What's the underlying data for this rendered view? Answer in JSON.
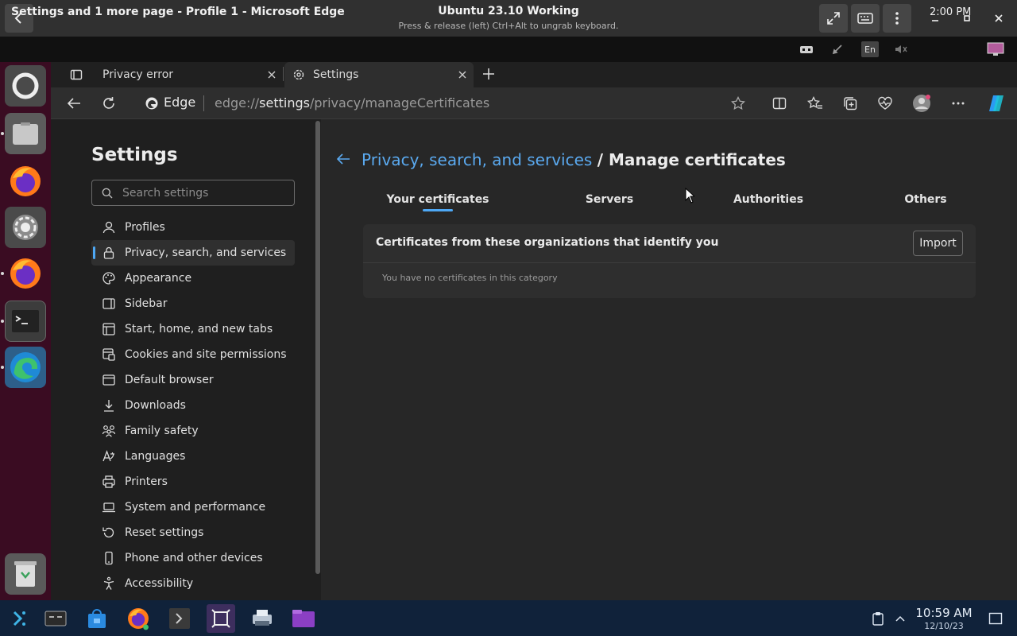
{
  "vm": {
    "title": "Ubuntu 23.10 Working",
    "subtitle": "Press & release (left) Ctrl+Alt to ungrab keyboard."
  },
  "panel": {
    "window_title": "Settings and 1 more page - Profile 1 - Microsoft Edge",
    "keyboard_layout": "En",
    "time": "2:00 PM"
  },
  "browser": {
    "tabs": [
      {
        "label": "Privacy error"
      },
      {
        "label": "Settings"
      }
    ],
    "site_label": "Edge",
    "url_prefix": "edge://",
    "url_strong": "settings",
    "url_rest": "/privacy/manageCertificates"
  },
  "settings": {
    "title": "Settings",
    "search_placeholder": "Search settings",
    "nav": [
      {
        "label": "Profiles",
        "icon": "profile-icon"
      },
      {
        "label": "Privacy, search, and services",
        "icon": "lock-icon"
      },
      {
        "label": "Appearance",
        "icon": "appearance-icon"
      },
      {
        "label": "Sidebar",
        "icon": "sidebar-icon"
      },
      {
        "label": "Start, home, and new tabs",
        "icon": "home-icon"
      },
      {
        "label": "Cookies and site permissions",
        "icon": "cookies-icon"
      },
      {
        "label": "Default browser",
        "icon": "browser-icon"
      },
      {
        "label": "Downloads",
        "icon": "download-icon"
      },
      {
        "label": "Family safety",
        "icon": "family-icon"
      },
      {
        "label": "Languages",
        "icon": "language-icon"
      },
      {
        "label": "Printers",
        "icon": "printer-icon"
      },
      {
        "label": "System and performance",
        "icon": "laptop-icon"
      },
      {
        "label": "Reset settings",
        "icon": "reset-icon"
      },
      {
        "label": "Phone and other devices",
        "icon": "phone-icon"
      },
      {
        "label": "Accessibility",
        "icon": "accessibility-icon"
      }
    ]
  },
  "certificates": {
    "breadcrumb_parent": "Privacy, search, and services",
    "breadcrumb_current": "/ Manage certificates",
    "tabs": [
      "Your certificates",
      "Servers",
      "Authorities",
      "Others"
    ],
    "card_heading": "Certificates from these organizations that identify you",
    "import_label": "Import",
    "empty_message": "You have no certificates in this category"
  },
  "taskbar": {
    "time": "10:59 AM",
    "date": "12/10/23"
  },
  "colors": {
    "accent": "#4ea8f5",
    "link": "#5aa9ef",
    "dock": "#3a0c22",
    "taskbar": "#10223a"
  }
}
